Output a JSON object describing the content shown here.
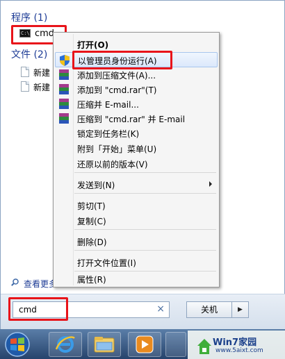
{
  "start_menu": {
    "programs_header": "程序 (1)",
    "files_header": "文件 (2)",
    "program_item": {
      "label": "cmd",
      "icon": "cmd-icon"
    },
    "file_items": [
      {
        "label": "新建",
        "icon": "text-document-icon"
      },
      {
        "label": "新建",
        "icon": "text-document-icon"
      }
    ],
    "see_more_label": "查看更多",
    "search": {
      "value": "cmd",
      "clear_symbol": "×"
    },
    "shutdown": {
      "label": "关机",
      "arrow": "▶"
    }
  },
  "context_menu": {
    "items": [
      {
        "label": "打开(O)",
        "bold": true,
        "icon": "none"
      },
      {
        "label": "以管理员身份运行(A)",
        "icon": "uac-shield-icon",
        "highlighted": true
      },
      {
        "label": "添加到压缩文件(A)...",
        "icon": "winrar-icon"
      },
      {
        "label": "添加到 \"cmd.rar\"(T)",
        "icon": "winrar-icon"
      },
      {
        "label": "压缩并 E-mail...",
        "icon": "winrar-icon"
      },
      {
        "label": "压缩到 \"cmd.rar\" 并 E-mail",
        "icon": "winrar-icon"
      },
      {
        "label": "锁定到任务栏(K)",
        "icon": "none"
      },
      {
        "label": "附到「开始」菜单(U)",
        "icon": "none"
      },
      {
        "label": "还原以前的版本(V)",
        "icon": "none"
      },
      {
        "label": "发送到(N)",
        "icon": "none",
        "submenu": true
      },
      {
        "label": "剪切(T)",
        "icon": "none"
      },
      {
        "label": "复制(C)",
        "icon": "none"
      },
      {
        "label": "删除(D)",
        "icon": "none"
      },
      {
        "label": "打开文件位置(I)",
        "icon": "none"
      },
      {
        "label": "属性(R)",
        "icon": "none"
      }
    ]
  },
  "taskbar": {
    "buttons": [
      "start-orb-icon",
      "internet-explorer-icon",
      "windows-explorer-icon",
      "media-player-icon"
    ]
  },
  "watermark": {
    "title": "Win7家园",
    "url": "www.5aixt.com"
  },
  "colors": {
    "highlight": "#e8141a",
    "header_blue": "#1e3c96",
    "taskbar": "#2f4f7c"
  }
}
